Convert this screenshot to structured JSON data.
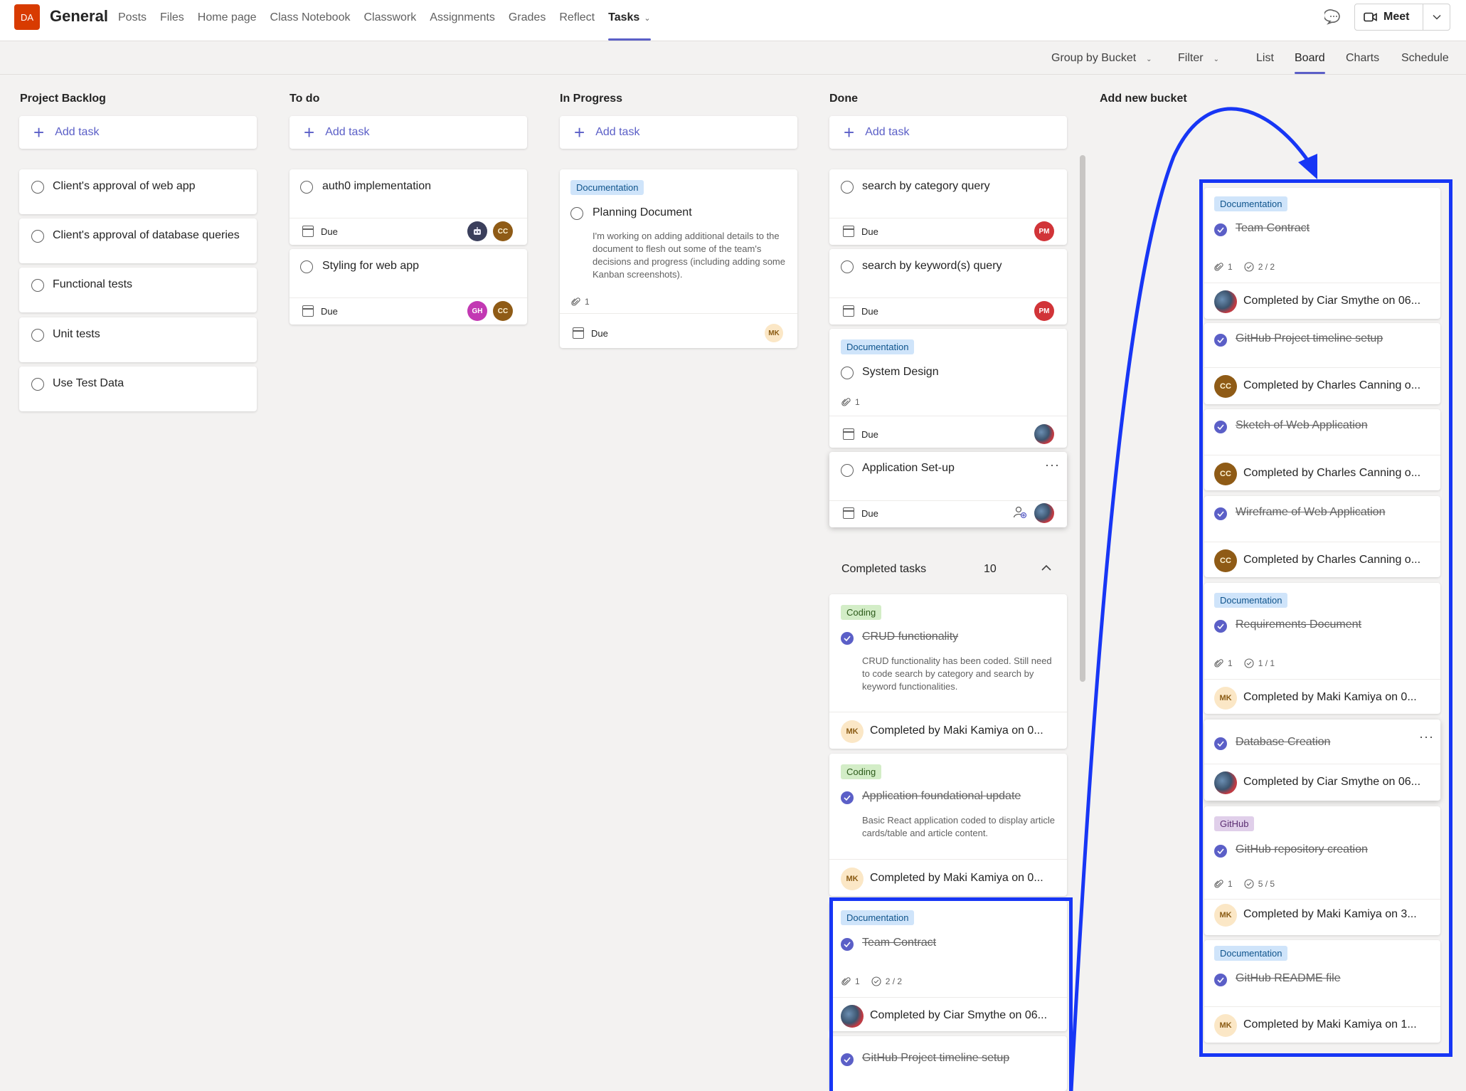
{
  "header": {
    "team_initials": "DA",
    "channel": "General",
    "tabs": [
      "Posts",
      "Files",
      "Home page",
      "Class Notebook",
      "Classwork",
      "Assignments",
      "Grades",
      "Reflect",
      "Tasks"
    ],
    "meet_label": "Meet"
  },
  "toolbar": {
    "group_by": "Group by Bucket",
    "filter": "Filter",
    "views": [
      "List",
      "Board",
      "Charts",
      "Schedule"
    ]
  },
  "board": {
    "add_task_label": "Add task",
    "buckets": [
      {
        "title": "Project Backlog",
        "tasks": [
          "Client's approval of web app",
          "Client's approval of database queries",
          "Functional tests",
          "Unit tests",
          "Use Test Data"
        ]
      },
      {
        "title": "To do",
        "tasks": [
          "auth0 implementation",
          "Styling for web app"
        ]
      },
      {
        "title": "In Progress",
        "tasks": [
          "Planning Document"
        ]
      },
      {
        "title": "Done",
        "tasks": [
          "search by category query",
          "search by keyword(s) query",
          "System Design",
          "Application Set-up"
        ]
      }
    ],
    "add_bucket_label": "Add new bucket",
    "due_label": "Due",
    "planning_desc": "I'm working on adding additional details to the document to flesh out some of the team's decisions and progress (including adding some Kanban screenshots).",
    "labels": {
      "documentation": "Documentation",
      "coding": "Coding",
      "github": "GitHub"
    },
    "avatars": {
      "cc": "CC",
      "gh": "GH",
      "pm": "PM",
      "mk": "MK"
    },
    "attach_one": "1",
    "completed_section": {
      "label": "Completed tasks",
      "count": "10"
    },
    "done_completed": [
      {
        "title": "CRUD functionality",
        "desc": "CRUD functionality has been coded. Still need to code search by category and search by keyword functionalities.",
        "by": "Completed by Maki Kamiya on 0..."
      },
      {
        "title": "Application foundational update",
        "desc": "Basic React application coded to display article cards/table and article content.",
        "by": "Completed by Maki Kamiya on 0..."
      },
      {
        "title": "Team Contract",
        "checklist": "2 / 2",
        "by": "Completed by Ciar Smythe on 06..."
      },
      {
        "title": "GitHub Project timeline setup"
      }
    ],
    "right_completed": [
      {
        "title": "Team Contract",
        "checklist": "2 / 2",
        "by": "Completed by Ciar Smythe on 06..."
      },
      {
        "title": "GitHub Project timeline setup",
        "by": "Completed by Charles Canning o..."
      },
      {
        "title": "Sketch of Web Application",
        "by": "Completed by Charles Canning o..."
      },
      {
        "title": "Wireframe of Web Application",
        "by": "Completed by Charles Canning o..."
      },
      {
        "title": "Requirements Document",
        "checklist": "1 / 1",
        "by": "Completed by Maki Kamiya on 0..."
      },
      {
        "title": "Database Creation",
        "by": "Completed by Ciar Smythe on 06..."
      },
      {
        "title": "GitHub repository creation",
        "checklist": "5 / 5",
        "by": "Completed by Maki Kamiya on 3..."
      },
      {
        "title": "GitHub README file",
        "by": "Completed by Maki Kamiya on 1..."
      }
    ]
  },
  "colors": {
    "accent": "#5b5fc7",
    "annotation": "#1736f5"
  }
}
